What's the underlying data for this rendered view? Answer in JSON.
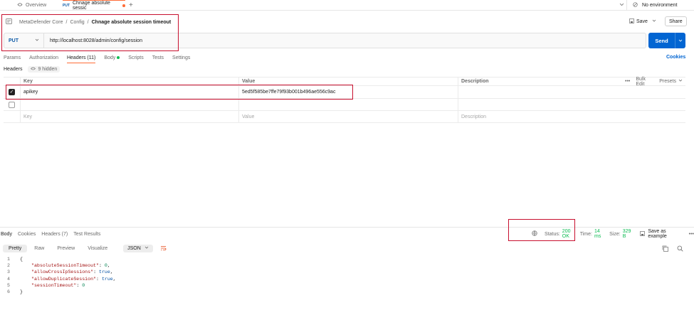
{
  "tabs": {
    "overview": "Overview",
    "request_method": "PUT",
    "request_title": "Chnage absolute sessic",
    "environment": "No environment"
  },
  "breadcrumb": {
    "root": "MetaDefender Core",
    "folder": "Config",
    "current": "Chnage absolute session timeout"
  },
  "toolbar": {
    "save": "Save",
    "share": "Share"
  },
  "request": {
    "method": "PUT",
    "url": "http://localhost:8028/admin/config/session",
    "send": "Send"
  },
  "subtabs": {
    "params": "Params",
    "authorization": "Authorization",
    "headers": "Headers (11)",
    "body": "Body",
    "scripts": "Scripts",
    "tests": "Tests",
    "settings": "Settings",
    "cookies": "Cookies"
  },
  "headers_section": {
    "label": "Headers",
    "hidden": "9 hidden"
  },
  "table": {
    "columns": {
      "key": "Key",
      "value": "Value",
      "description": "Description"
    },
    "bulk_edit": "Bulk Edit",
    "presets": "Presets",
    "rows": [
      {
        "checked": true,
        "key": "apikey",
        "value": "5ed5f585be7ffe79f93b001b496ae556c9ac",
        "description": ""
      },
      {
        "checked": false,
        "key": "",
        "value": "",
        "description": ""
      }
    ],
    "placeholder": {
      "key": "Key",
      "value": "Value",
      "description": "Description"
    }
  },
  "response": {
    "tabs": {
      "body": "Body",
      "cookies": "Cookies",
      "headers": "Headers (7)",
      "test_results": "Test Results"
    },
    "status_label": "Status:",
    "status_value": "200 OK",
    "time_label": "Time:",
    "time_value": "14 ms",
    "size_label": "Size:",
    "size_value": "329 B",
    "save_example": "Save as example",
    "formats": {
      "pretty": "Pretty",
      "raw": "Raw",
      "preview": "Preview",
      "visualize": "Visualize"
    },
    "language": "JSON",
    "lines": [
      {
        "n": "1",
        "text": "{"
      },
      {
        "n": "2",
        "key": "\"absoluteSessionTimeout\"",
        "val": "0",
        "kind": "num",
        "comma": ","
      },
      {
        "n": "3",
        "key": "\"allowCrossIpSessions\"",
        "val": "true",
        "kind": "bool",
        "comma": ","
      },
      {
        "n": "4",
        "key": "\"allowDuplicateSession\"",
        "val": "true",
        "kind": "bool",
        "comma": ","
      },
      {
        "n": "5",
        "key": "\"sessionTimeout\"",
        "val": "0",
        "kind": "num",
        "comma": ""
      },
      {
        "n": "6",
        "text": "}"
      }
    ]
  }
}
